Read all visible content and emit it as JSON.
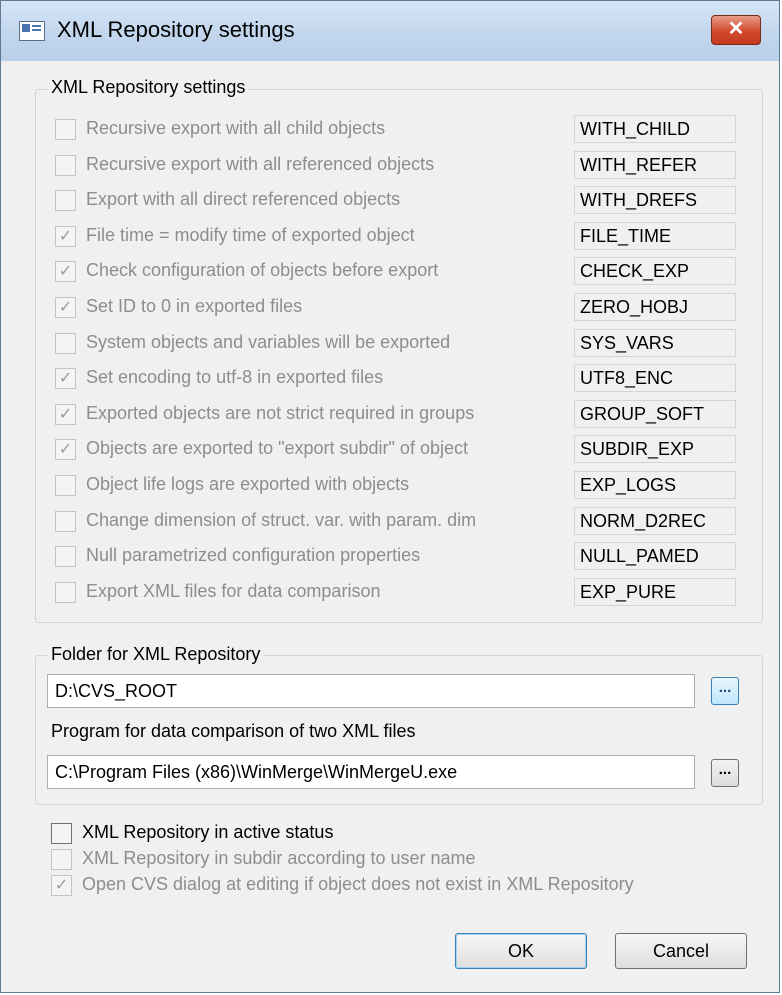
{
  "window": {
    "title": "XML Repository settings",
    "close_symbol": "✕",
    "app_icon": "window-app-icon"
  },
  "settings_group": {
    "label": "XML Repository settings",
    "rows": [
      {
        "label": "Recursive export with all child objects",
        "code": "WITH_CHILD",
        "checked": false
      },
      {
        "label": "Recursive export with all referenced objects",
        "code": "WITH_REFER",
        "checked": false
      },
      {
        "label": "Export with all direct referenced objects",
        "code": "WITH_DREFS",
        "checked": false
      },
      {
        "label": "File time = modify time of exported object",
        "code": "FILE_TIME",
        "checked": true
      },
      {
        "label": "Check configuration of objects before export",
        "code": "CHECK_EXP",
        "checked": true
      },
      {
        "label": "Set ID to 0 in exported files",
        "code": "ZERO_HOBJ",
        "checked": true
      },
      {
        "label": "System objects and variables will be exported",
        "code": "SYS_VARS",
        "checked": false
      },
      {
        "label": "Set encoding to utf-8 in exported files",
        "code": "UTF8_ENC",
        "checked": true
      },
      {
        "label": "Exported objects are not strict required in groups",
        "code": "GROUP_SOFT",
        "checked": true
      },
      {
        "label": "Objects are exported to \"export subdir\" of object",
        "code": "SUBDIR_EXP",
        "checked": true
      },
      {
        "label": "Object life logs are exported with objects",
        "code": "EXP_LOGS",
        "checked": false
      },
      {
        "label": "Change dimension of struct. var. with param. dim",
        "code": "NORM_D2REC",
        "checked": false
      },
      {
        "label": "Null parametrized configuration properties",
        "code": "NULL_PAMED",
        "checked": false
      },
      {
        "label": "Export XML files for data comparison",
        "code": "EXP_PURE",
        "checked": false
      }
    ]
  },
  "folder_group": {
    "label": "Folder for XML Repository",
    "value": "D:\\CVS_ROOT",
    "browse_label": "..."
  },
  "compare_group": {
    "label": "Program for data comparison of two XML files",
    "value": "C:\\Program Files (x86)\\WinMerge\\WinMergeU.exe",
    "browse_label": "..."
  },
  "options": [
    {
      "label": "XML Repository in active status",
      "checked": false,
      "enabled": true
    },
    {
      "label": "XML Repository in subdir according to user name",
      "checked": false,
      "enabled": false
    },
    {
      "label": "Open CVS dialog at editing if object does not exist in XML Repository",
      "checked": true,
      "enabled": false
    }
  ],
  "buttons": {
    "ok": "OK",
    "cancel": "Cancel"
  },
  "check_glyph": "✓",
  "colors": {
    "title_bar": "#c3d7ee",
    "close_button": "#d14a2e",
    "dialog_bg": "#f0f0f0",
    "disabled_text": "#8d8d8d",
    "active_browse": "#3c7fb1"
  }
}
